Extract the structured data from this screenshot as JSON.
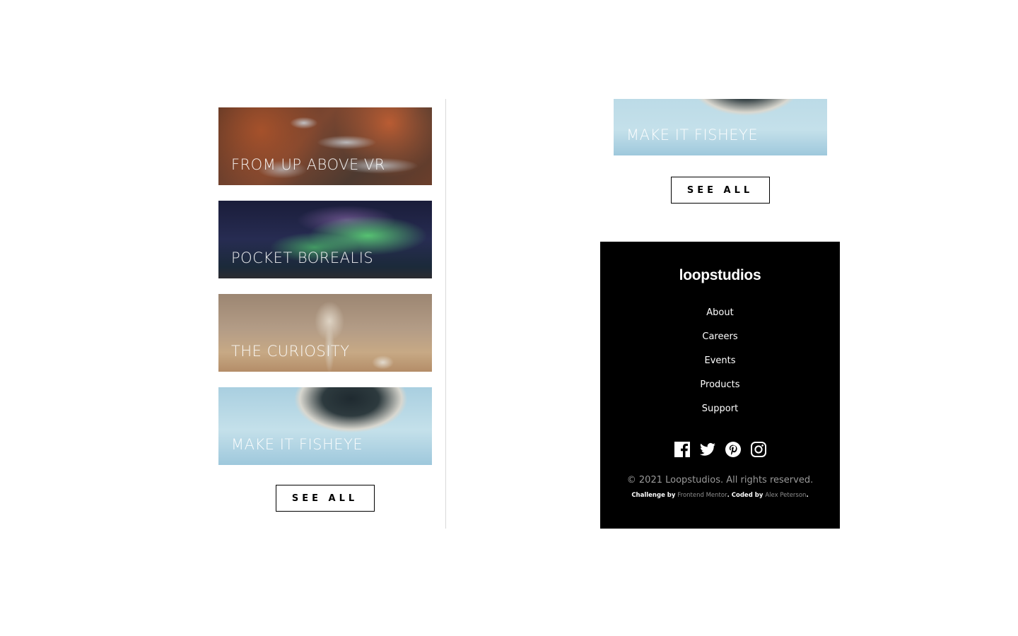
{
  "creations_left": [
    {
      "title": "From up above VR",
      "image": "aerial-winding-roads-photo"
    },
    {
      "title": "Pocket borealis",
      "image": "aurora-borealis-photo"
    },
    {
      "title": "The curiosity",
      "image": "mars-rover-photo"
    },
    {
      "title": "Make it fisheye",
      "image": "fisheye-landscape-photo"
    }
  ],
  "creations_right": {
    "cropped_card_title": "Make it fisheye",
    "cropped_card_image": "fisheye-landscape-photo"
  },
  "buttons": {
    "see_all_left": "SEE ALL",
    "see_all_right": "SEE ALL"
  },
  "footer": {
    "logo": "loopstudios",
    "nav": [
      "About",
      "Careers",
      "Events",
      "Products",
      "Support"
    ],
    "social_icons": [
      "facebook-icon",
      "twitter-icon",
      "pinterest-icon",
      "instagram-icon"
    ],
    "copyright": "© 2021 Loopstudios. All rights reserved.",
    "attribution": {
      "challenge_prefix": "Challenge by ",
      "challenge_link": "Frontend Mentor",
      "coded_prefix": ". Coded by ",
      "coded_link": "Alex Peterson",
      "suffix": "."
    }
  },
  "colors": {
    "background": "#ffffff",
    "footer_bg": "#000000",
    "footer_text": "#ffffff",
    "copyright_text": "#9a9a9a",
    "divider": "#d9d9d9"
  }
}
